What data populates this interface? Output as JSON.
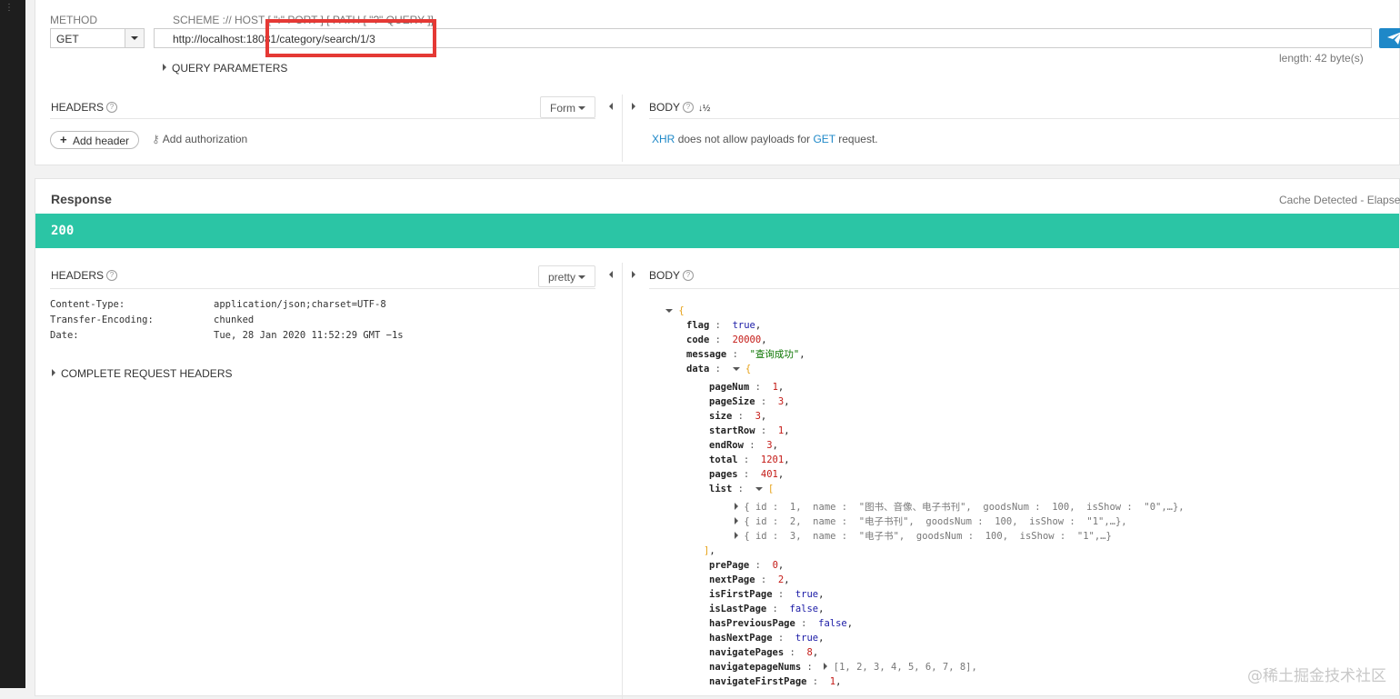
{
  "request": {
    "method_label": "METHOD",
    "method_value": "GET",
    "scheme_label": "SCHEME :// HOST [ \":\" PORT ] [ PATH [ \"?\" QUERY ]]",
    "url": "http://localhost:18081/category/search/1/3",
    "length": "length: 42 byte(s)",
    "query_parameters": "QUERY PARAMETERS",
    "headers_title": "HEADERS",
    "headers_mode": "Form",
    "add_header": "Add header",
    "add_authorization": "Add authorization",
    "body_title": "BODY",
    "body_msg_xhr": "XHR",
    "body_msg_middle": "does not allow payloads for",
    "body_msg_get": "GET",
    "body_msg_end": "request."
  },
  "response": {
    "title": "Response",
    "cache_text": "Cache Detected - Elapsed",
    "status": "200",
    "headers_title": "HEADERS",
    "headers_mode": "pretty",
    "body_title": "BODY",
    "headers": [
      {
        "k": "Content-Type:",
        "v": "application/json;charset=UTF-8"
      },
      {
        "k": "Transfer-Encoding:",
        "v": "chunked"
      },
      {
        "k": "Date:",
        "v": "Tue, 28 Jan 2020 11:52:29 GMT −1s"
      }
    ],
    "complete_request_headers": "COMPLETE REQUEST HEADERS",
    "json": {
      "flag": "true",
      "code": "20000",
      "message": "\"查询成功\"",
      "pageNum": "1",
      "pageSize": "3",
      "size": "3",
      "startRow": "1",
      "endRow": "3",
      "total": "1201",
      "pages": "401",
      "list_items": [
        "{ id :  1,  name :  \"图书、音像、电子书刊\",  goodsNum :  100,  isShow :  \"0\",…},",
        "{ id :  2,  name :  \"电子书刊\",  goodsNum :  100,  isShow :  \"1\",…},",
        "{ id :  3,  name :  \"电子书\",  goodsNum :  100,  isShow :  \"1\",…}"
      ],
      "prePage": "0",
      "nextPage": "2",
      "isFirstPage": "true",
      "isLastPage": "false",
      "hasPreviousPage": "false",
      "hasNextPage": "true",
      "navigatePages": "8",
      "navigatepageNums": "[1, 2, 3, 4, 5, 6, 7, 8],",
      "navigateFirstPage": "1"
    }
  },
  "watermark": "@稀土掘金技术社区",
  "colors": {
    "status_bar": "#2bc5a5",
    "accent": "#1e88c8",
    "highlight_box": "#e53935"
  }
}
